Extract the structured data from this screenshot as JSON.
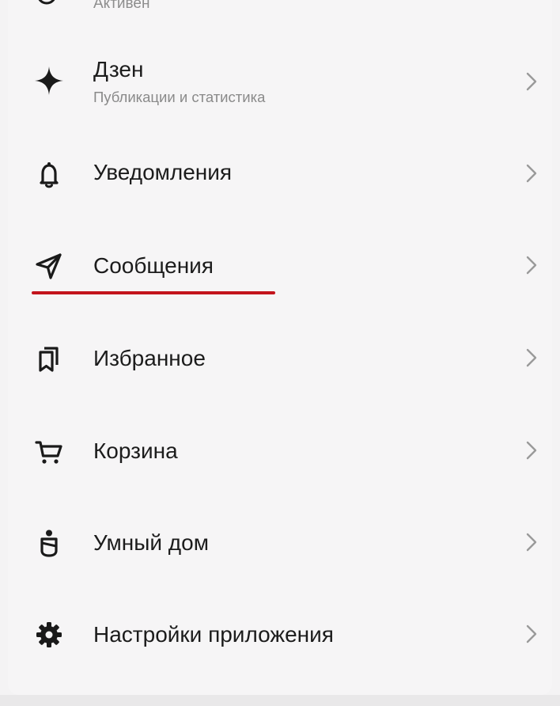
{
  "header": {
    "status": "Активен"
  },
  "menu": {
    "items": [
      {
        "label": "Дзен",
        "subtitle": "Публикации и статистика",
        "icon": "sparkle-icon"
      },
      {
        "label": "Уведомления",
        "icon": "bell-icon"
      },
      {
        "label": "Сообщения",
        "icon": "send-icon",
        "highlighted": true
      },
      {
        "label": "Избранное",
        "icon": "bookmarks-icon"
      },
      {
        "label": "Корзина",
        "icon": "cart-icon"
      },
      {
        "label": "Умный дом",
        "icon": "smart-home-icon"
      },
      {
        "label": "Настройки приложения",
        "icon": "gear-icon"
      }
    ]
  },
  "colors": {
    "background": "#f4f3f4",
    "text": "#1c1c1c",
    "secondary_text": "#8a8a8a",
    "chevron": "#9a9a9a",
    "annotation_underline": "#c3141c"
  }
}
